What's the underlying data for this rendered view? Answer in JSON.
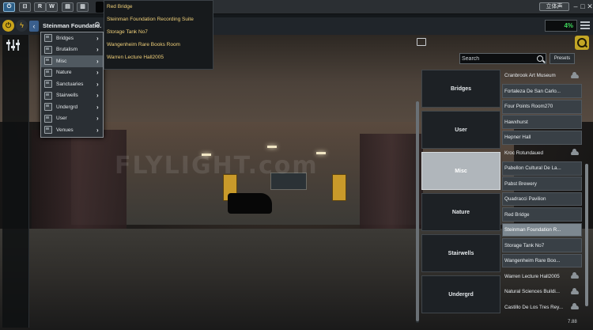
{
  "topbar": {
    "buttons": [
      {
        "name": "power-button",
        "label": "⏻"
      },
      {
        "name": "ab-button",
        "label": "⊡"
      },
      {
        "name": "rw-r-button",
        "label": "R"
      },
      {
        "name": "rw-w-button",
        "label": "W"
      },
      {
        "name": "preset-a-button",
        "label": "▤"
      },
      {
        "name": "preset-b-button",
        "label": "▥"
      }
    ],
    "language": "立体声",
    "window_controls": [
      "–",
      "□",
      "✕"
    ]
  },
  "toolbar": {
    "power_label": "⏻",
    "bolt_label": "ϟ",
    "back_label": "‹",
    "preset_title": "Steinman Foundatio...",
    "dot_menu": "⚙",
    "mix_value": "4%"
  },
  "category_menu": {
    "items": [
      {
        "label": "Bridges"
      },
      {
        "label": "Brutalism"
      },
      {
        "label": "Misc"
      },
      {
        "label": "Nature"
      },
      {
        "label": "Sanctuaries"
      },
      {
        "label": "Stairwells"
      },
      {
        "label": "Undergrd"
      },
      {
        "label": "User"
      },
      {
        "label": "Venues"
      }
    ],
    "active_index": 2,
    "arrow": "›"
  },
  "submenu": {
    "items": [
      "Red Bridge",
      "Steinman Foundation Recording Suite",
      "Storage Tank No7",
      "Wangenheim Rare Books Room",
      "Warren Lecture Hall2005"
    ]
  },
  "viewer": {
    "watermark": "FLYLIGHT.com"
  },
  "browser": {
    "search_placeholder": "Search",
    "presets_label": "Presets",
    "category_tiles": [
      "Bridges",
      "User",
      "Misc",
      "Nature",
      "Stairwells",
      "Undergrd"
    ],
    "selected_tile": "Misc",
    "preset_items": [
      {
        "label": "Cranbrook Art Museum",
        "style": "plain",
        "cloud": true
      },
      {
        "label": "Fortaleza De San Carlo...",
        "style": "normal",
        "cloud": false
      },
      {
        "label": "Four Points Room270",
        "style": "normal",
        "cloud": false
      },
      {
        "label": "Hawxhurst",
        "style": "normal",
        "cloud": false
      },
      {
        "label": "Hepner Hall",
        "style": "normal",
        "cloud": false
      },
      {
        "label": "Kroc Rotundaued",
        "style": "plain",
        "cloud": true
      },
      {
        "label": "Pabellon Cultural De La...",
        "style": "normal",
        "cloud": false
      },
      {
        "label": "Pabst Brewery",
        "style": "normal",
        "cloud": false
      },
      {
        "label": "Quadracci Pavilion",
        "style": "normal",
        "cloud": false
      },
      {
        "label": "Red Bridge",
        "style": "normal",
        "cloud": false
      },
      {
        "label": "Steinman Foundation R...",
        "style": "selected",
        "cloud": false
      },
      {
        "label": "Storage Tank No7",
        "style": "normal",
        "cloud": false
      },
      {
        "label": "Wangenheim Rare Boo...",
        "style": "normal",
        "cloud": false
      },
      {
        "label": "Warren Lecture Hall2005",
        "style": "plain",
        "cloud": true
      },
      {
        "label": "Natural Sciences Buildi...",
        "style": "plain",
        "cloud": true
      },
      {
        "label": "Castillo De Los Tres Rey...",
        "style": "plain",
        "cloud": true
      }
    ]
  },
  "status": {
    "version": "7.88"
  },
  "colors": {
    "accent_green": "#3fd85b",
    "accent_yellow": "#caa41a",
    "submenu_text": "#f0d07a",
    "selected_tile": "#b0b6bb"
  }
}
